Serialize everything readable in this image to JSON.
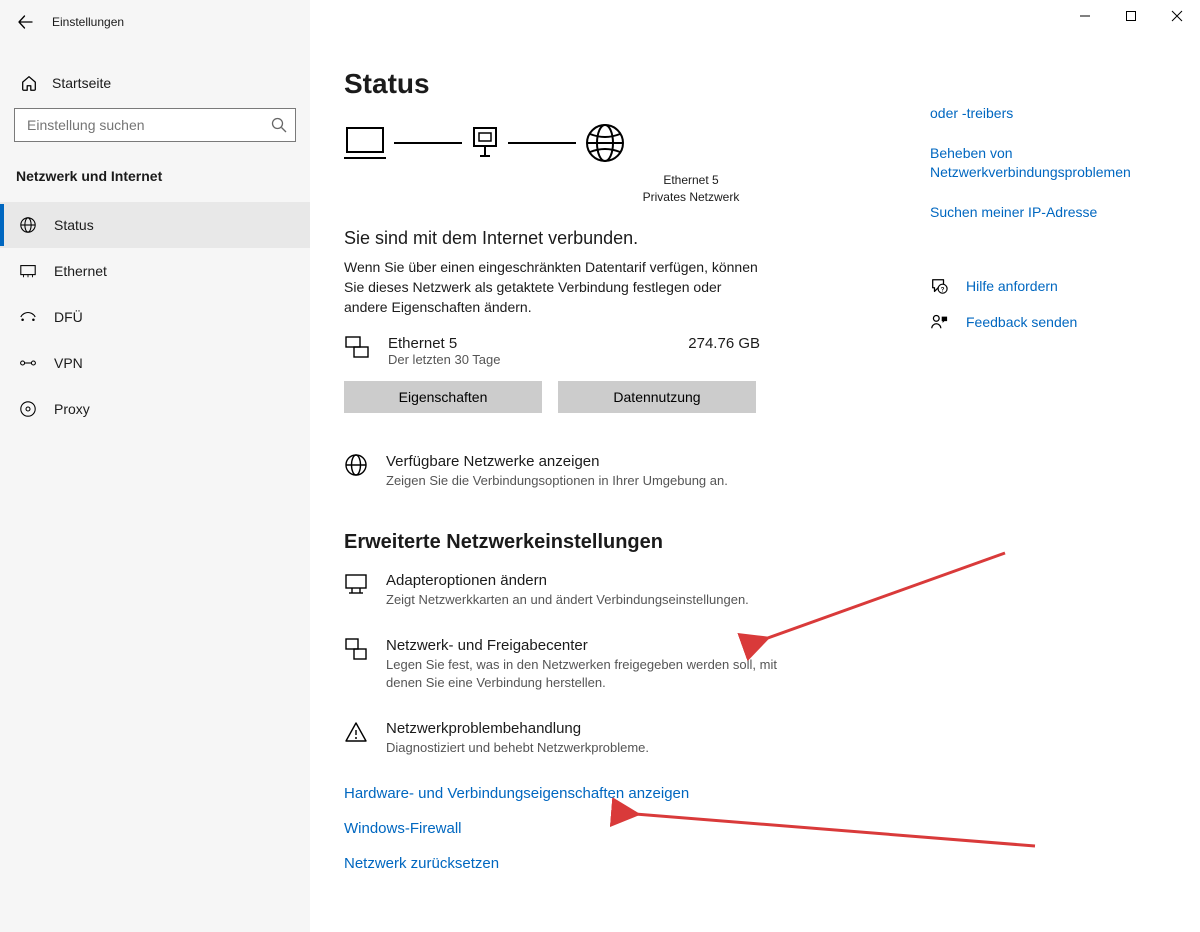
{
  "window": {
    "title": "Einstellungen"
  },
  "sidebar": {
    "home": "Startseite",
    "search_placeholder": "Einstellung suchen",
    "section": "Netzwerk und Internet",
    "items": [
      {
        "label": "Status"
      },
      {
        "label": "Ethernet"
      },
      {
        "label": "DFÜ"
      },
      {
        "label": "VPN"
      },
      {
        "label": "Proxy"
      }
    ]
  },
  "main": {
    "title": "Status",
    "diagram": {
      "adapter": "Ethernet 5",
      "network_type": "Privates Netzwerk"
    },
    "connected_heading": "Sie sind mit dem Internet verbunden.",
    "connected_body": "Wenn Sie über einen eingeschränkten Datentarif verfügen, können Sie dieses Netzwerk als getaktete Verbindung festlegen oder andere Eigenschaften ändern.",
    "usage": {
      "adapter": "Ethernet 5",
      "period": "Der letzten 30 Tage",
      "amount": "274.76 GB",
      "properties_btn": "Eigenschaften",
      "dataUsage_btn": "Datennutzung"
    },
    "available_networks": {
      "title": "Verfügbare Netzwerke anzeigen",
      "sub": "Zeigen Sie die Verbindungsoptionen in Ihrer Umgebung an."
    },
    "advanced_heading": "Erweiterte Netzwerkeinstellungen",
    "adv": [
      {
        "title": "Adapteroptionen ändern",
        "sub": "Zeigt Netzwerkkarten an und ändert Verbindungseinstellungen."
      },
      {
        "title": "Netzwerk- und Freigabecenter",
        "sub": "Legen Sie fest, was in den Netzwerken freigegeben werden soll, mit denen Sie eine Verbindung herstellen."
      },
      {
        "title": "Netzwerkproblembehandlung",
        "sub": "Diagnostiziert und behebt Netzwerkprobleme."
      }
    ],
    "links": {
      "hardware": "Hardware- und Verbindungseigenschaften anzeigen",
      "firewall": "Windows-Firewall",
      "reset": "Netzwerk zurücksetzen"
    }
  },
  "right": {
    "links": [
      "oder -treibers",
      "Beheben von Netzwerkverbindungsproblemen",
      "Suchen meiner IP-Adresse"
    ],
    "help": "Hilfe anfordern",
    "feedback": "Feedback senden"
  }
}
